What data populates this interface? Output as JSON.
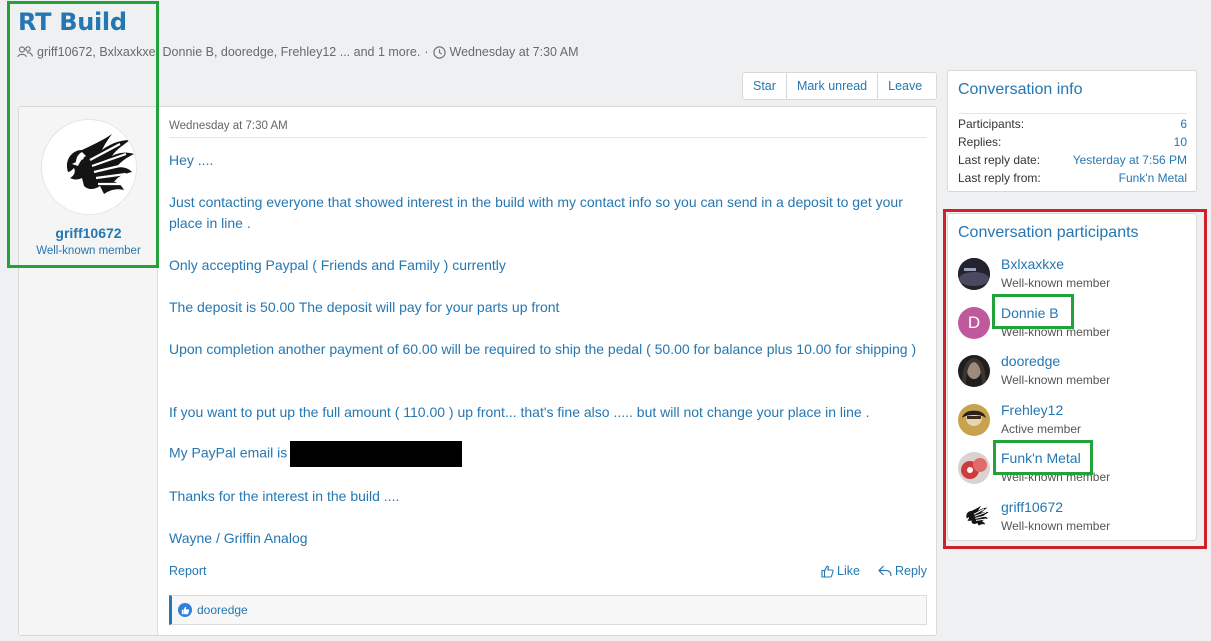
{
  "title": "RT Build",
  "meta": {
    "participants_text": "griff10672, Bxlxaxkxe, Donnie B, dooredge, Frehley12 ... and 1 more.",
    "separator": "·",
    "time": "Wednesday at 7:30 AM"
  },
  "actions": {
    "star": "Star",
    "mark_unread": "Mark unread",
    "leave": "Leave"
  },
  "message": {
    "author": "griff10672",
    "author_title": "Well-known member",
    "date": "Wednesday at 7:30 AM",
    "paragraphs": [
      "Hey ....",
      "Just contacting everyone that showed interest in the build with my contact info so you can send in a deposit to get your place in line .",
      "Only accepting Paypal ( Friends and Family ) currently",
      "The deposit is 50.00 The deposit will pay for your parts up front",
      "Upon completion another payment of 60.00 will be required to ship the pedal ( 50.00 for balance plus 10.00 for shipping )",
      "If you want to put up the full amount ( 110.00 ) up front... that's fine also ..... but will not change your place in line .",
      "My PayPal email is",
      "Thanks for the interest in the build ....",
      "Wayne / Griffin Analog"
    ],
    "report": "Report",
    "like": "Like",
    "reply": "Reply",
    "reaction_user": "dooredge"
  },
  "info": {
    "title": "Conversation info",
    "rows": [
      {
        "k": "Participants:",
        "v": "6"
      },
      {
        "k": "Replies:",
        "v": "10"
      },
      {
        "k": "Last reply date:",
        "v": "Yesterday at 7:56 PM"
      },
      {
        "k": "Last reply from:",
        "v": "Funk'n Metal"
      }
    ]
  },
  "participants": {
    "title": "Conversation participants",
    "items": [
      {
        "name": "Bxlxaxkxe",
        "title": "Well-known member"
      },
      {
        "name": "Donnie B",
        "title": "Well-known member",
        "initial": "D"
      },
      {
        "name": "dooredge",
        "title": "Well-known member"
      },
      {
        "name": "Frehley12",
        "title": "Active member"
      },
      {
        "name": "Funk'n Metal",
        "title": "Well-known member"
      },
      {
        "name": "griff10672",
        "title": "Well-known member"
      }
    ]
  },
  "colors": {
    "link": "#2577b1",
    "highlight_green": "#21a339",
    "highlight_red": "#d0202a",
    "donnie_avatar": "#c0599c"
  }
}
